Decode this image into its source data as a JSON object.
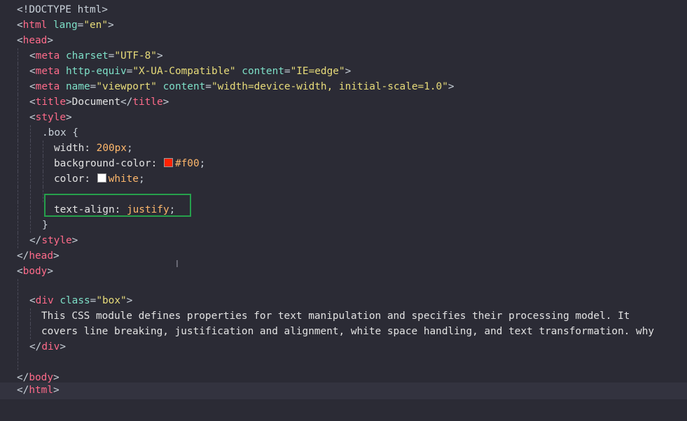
{
  "editor": {
    "lines": {
      "doctype": "<!DOCTYPE html>",
      "html_open_tag": "html",
      "html_lang_attr": "lang",
      "html_lang_value": "\"en\"",
      "head_open_tag": "head",
      "meta1_tag": "meta",
      "meta1_attr": "charset",
      "meta1_value": "\"UTF-8\"",
      "meta2_tag": "meta",
      "meta2_attr1": "http-equiv",
      "meta2_value1": "\"X-UA-Compatible\"",
      "meta2_attr2": "content",
      "meta2_value2": "\"IE=edge\"",
      "meta3_tag": "meta",
      "meta3_attr1": "name",
      "meta3_value1": "\"viewport\"",
      "meta3_attr2": "content",
      "meta3_value2": "\"width=device-width, initial-scale=1.0\"",
      "title_tag": "title",
      "title_text": "Document",
      "style_tag": "style",
      "selector": ".box {",
      "width_prop": "width:",
      "width_val": "200px",
      "bg_prop": "background-color:",
      "bg_val": "#f00",
      "color_prop": "color:",
      "color_val": "white",
      "align_prop": "text-align:",
      "align_val": "justify",
      "close_brace": "}",
      "head_close_tag": "head",
      "body_tag": "body",
      "div_tag": "div",
      "div_attr": "class",
      "div_value": "\"box\"",
      "para_line1": "This CSS module defines properties for text manipulation and specifies their processing model. It",
      "para_line2": "covers line breaking, justification and alignment, white space handling, and text transformation. why",
      "html_close_tag": "html"
    },
    "swatch_colors": {
      "red": "#f00",
      "white": "#ffffff"
    },
    "highlight_color": "#26a04c",
    "cursor_icon": "text-cursor-icon"
  }
}
